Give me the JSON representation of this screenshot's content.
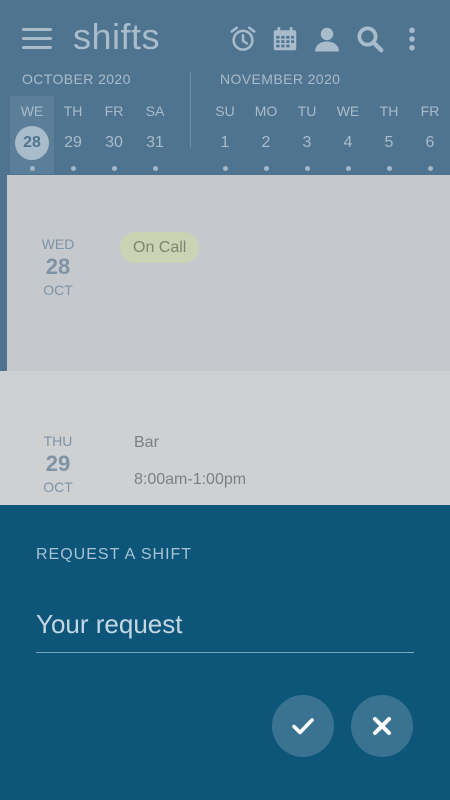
{
  "app": {
    "title": "shifts"
  },
  "toolbar": {
    "icons": [
      "alarm-icon",
      "calendar-icon",
      "person-icon",
      "search-icon",
      "more-vert-icon"
    ]
  },
  "calendar": {
    "months": [
      {
        "label": "OCTOBER 2020"
      },
      {
        "label": "NOVEMBER 2020"
      }
    ],
    "days": [
      {
        "name": "WE",
        "num": "28",
        "selected": true
      },
      {
        "name": "TH",
        "num": "29"
      },
      {
        "name": "FR",
        "num": "30"
      },
      {
        "name": "SA",
        "num": "31"
      },
      {
        "name": "SU",
        "num": "1"
      },
      {
        "name": "MO",
        "num": "2"
      },
      {
        "name": "TU",
        "num": "3"
      },
      {
        "name": "WE",
        "num": "4"
      },
      {
        "name": "TH",
        "num": "5"
      },
      {
        "name": "FR",
        "num": "6"
      }
    ]
  },
  "shifts": [
    {
      "weekday": "WED",
      "day": "28",
      "month": "OCT",
      "badge": "On Call"
    },
    {
      "weekday": "THU",
      "day": "29",
      "month": "OCT",
      "name": "Bar",
      "time": "8:00am-1:00pm"
    }
  ],
  "request_sheet": {
    "title": "REQUEST A SHIFT",
    "value": "",
    "placeholder": "Your request",
    "confirm_icon": "check-icon",
    "cancel_icon": "close-icon"
  },
  "colors": {
    "header": "#4f7490",
    "sheet": "#0d5679",
    "fab": "#3a7392",
    "badge": "#ccd3b4"
  }
}
